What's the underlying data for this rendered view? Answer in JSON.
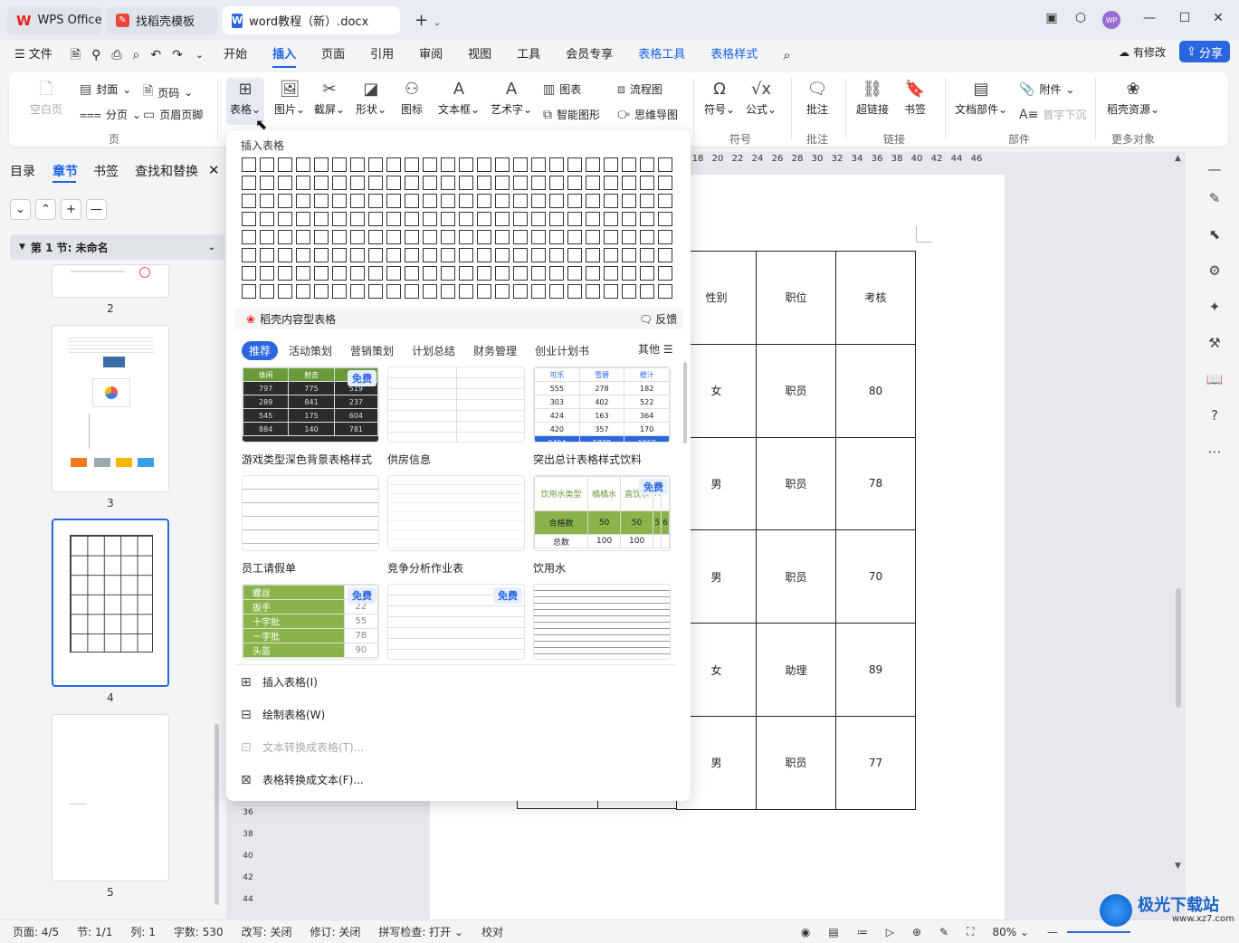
{
  "titlebar": {
    "tabs": [
      {
        "label": "WPS Office"
      },
      {
        "label": "找稻壳模板"
      },
      {
        "label": "word教程（新）.docx"
      }
    ],
    "new_tab": "+",
    "avatar_text": "WP"
  },
  "menu": {
    "file": "文件",
    "items": [
      "开始",
      "插入",
      "页面",
      "引用",
      "审阅",
      "视图",
      "工具",
      "会员专享"
    ],
    "tools": [
      "表格工具",
      "表格样式"
    ],
    "active": "插入",
    "revise": "有修改",
    "share": "分享"
  },
  "ribbon": {
    "blank_page": "空白页",
    "cover": "封面",
    "page_num": "页码",
    "page_break": "分页",
    "header_footer": "页眉页脚",
    "group_page": "页",
    "table": "表格",
    "picture": "图片",
    "screenshot": "截屏",
    "shape": "形状",
    "icon": "图标",
    "textbox": "文本框",
    "wordart": "艺术字",
    "chart": "图表",
    "smart_shape": "智能图形",
    "flowchart": "流程图",
    "mindmap": "思维导图",
    "symbol": "符号",
    "formula": "公式",
    "group_symbol": "符号",
    "comment": "批注",
    "group_comment": "批注",
    "hyperlink": "超链接",
    "bookmark": "书签",
    "group_link": "链接",
    "doc_parts": "文档部件",
    "attachment": "附件",
    "dropcap": "首字下沉",
    "group_parts": "部件",
    "daoke_res": "稻壳资源",
    "group_more": "更多对象"
  },
  "nav": {
    "tabs": [
      "目录",
      "章节",
      "书签",
      "查找和替换"
    ],
    "active_tab": "章节",
    "section": "第 1 节: 未命名",
    "pages": [
      "2",
      "3",
      "4",
      "5"
    ]
  },
  "ruler": {
    "ticks": [
      "18",
      "20",
      "22",
      "24",
      "26",
      "28",
      "30",
      "32",
      "34",
      "36",
      "38",
      "40",
      "42",
      "44",
      "46"
    ]
  },
  "vruler": [
    "36",
    "38",
    "40",
    "42",
    "44"
  ],
  "doc_table": {
    "header": [
      "性别",
      "职位",
      "考核"
    ],
    "rows": [
      [
        "女",
        "职员",
        "80"
      ],
      [
        "男",
        "职员",
        "78"
      ],
      [
        "男",
        "职员",
        "70"
      ],
      [
        "女",
        "助理",
        "89"
      ],
      [
        "男",
        "职员",
        "77"
      ]
    ]
  },
  "popup": {
    "insert_table_title": "插入表格",
    "content_tables": "稻壳内容型表格",
    "feedback": "反馈",
    "categories": [
      "推荐",
      "活动策划",
      "营销策划",
      "计划总结",
      "财务管理",
      "创业计划书"
    ],
    "more": "其他",
    "free_label": "免费",
    "cards": [
      {
        "title": "游戏类型深色背景表格样式",
        "free": true
      },
      {
        "title": "供房信息",
        "free": false
      },
      {
        "title": "突出总计表格样式饮料",
        "free": false
      },
      {
        "title": "员工请假单",
        "free": false
      },
      {
        "title": "竞争分析作业表",
        "free": false
      },
      {
        "title": "饮用水",
        "free": true
      },
      {
        "title": "",
        "free": true
      },
      {
        "title": "",
        "free": true
      },
      {
        "title": "",
        "free": false
      }
    ],
    "card1_head": [
      "体闲",
      "射击",
      ""
    ],
    "card1_rows": [
      [
        "797",
        "775",
        "519"
      ],
      [
        "289",
        "841",
        "237"
      ],
      [
        "545",
        "175",
        "604"
      ],
      [
        "884",
        "140",
        "781"
      ]
    ],
    "card3_head": [
      "可乐",
      "雪碧",
      "橙汁"
    ],
    "card3_rows": [
      [
        "555",
        "278",
        "182"
      ],
      [
        "303",
        "402",
        "522"
      ],
      [
        "424",
        "163",
        "364"
      ],
      [
        "420",
        "357",
        "170"
      ]
    ],
    "card3_total": [
      "2494",
      "1878",
      "1860"
    ],
    "card6_head": [
      "饮用水类型",
      "橘橘水",
      "直饮水",
      "X",
      ""
    ],
    "card6_row1": [
      "合格数",
      "50",
      "50",
      "5",
      "6"
    ],
    "card6_row2": [
      "总数",
      "100",
      "100",
      "",
      ""
    ],
    "card7_rows": [
      [
        "螺丝",
        "42"
      ],
      [
        "扳手",
        "22"
      ],
      [
        "十字批",
        "55"
      ],
      [
        "一字批",
        "78"
      ],
      [
        "头盔",
        "90"
      ]
    ],
    "actions": [
      {
        "label": "插入表格(I)",
        "disabled": false
      },
      {
        "label": "绘制表格(W)",
        "disabled": false
      },
      {
        "label": "文本转换成表格(T)...",
        "disabled": true
      },
      {
        "label": "表格转换成文本(F)...",
        "disabled": false
      }
    ]
  },
  "status": {
    "page": "页面: 4/5",
    "section": "节: 1/1",
    "col": "列: 1",
    "words": "字数: 530",
    "rewrite": "改写: 关闭",
    "track": "修订: 关闭",
    "spell": "拼写检查: 打开",
    "proof": "校对",
    "zoom": "80%"
  },
  "watermark": {
    "text": "极光下载站",
    "url": "www.xz7.com"
  },
  "colors": {
    "accent": "#1a62e8",
    "brand_red": "#e2231a"
  }
}
